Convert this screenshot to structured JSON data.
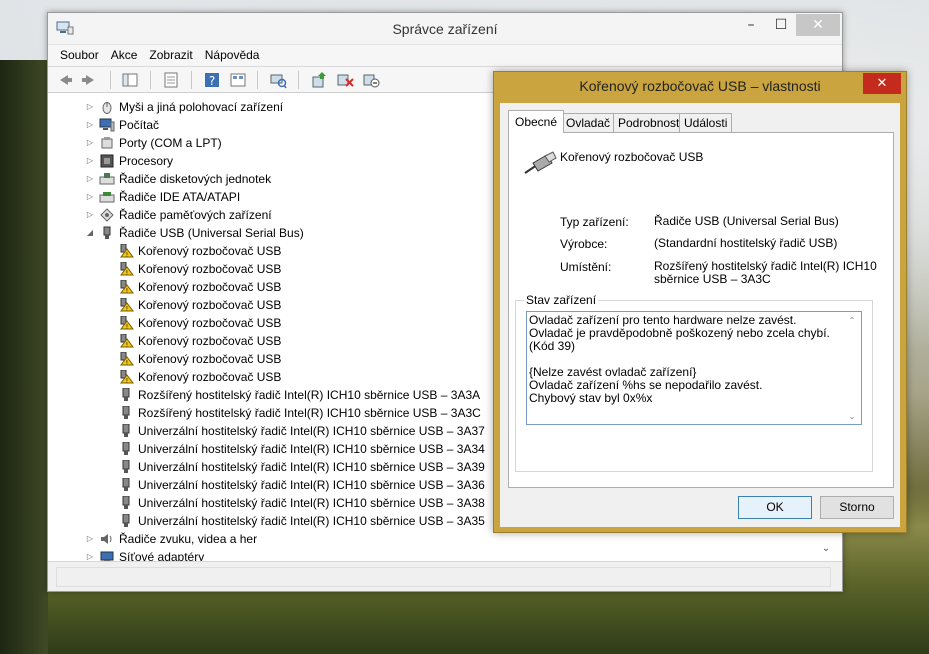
{
  "main_window": {
    "title": "Správce zařízení",
    "minimize": "–",
    "maximize": "☐",
    "close": "✕",
    "menu": [
      "Soubor",
      "Akce",
      "Zobrazit",
      "Nápověda"
    ],
    "toolbar_icons": [
      "back-icon",
      "forward-icon",
      "show-hide-tree-icon",
      "properties-icon",
      "help-icon",
      "view-icon",
      "scan-hardware-icon",
      "update-driver-icon",
      "uninstall-icon",
      "disable-icon"
    ],
    "tree": [
      {
        "label": "Myši a jiná polohovací zařízení",
        "level": 0,
        "expander": "▷",
        "icon": "mouse-icon"
      },
      {
        "label": "Počítač",
        "level": 0,
        "expander": "▷",
        "icon": "computer-icon"
      },
      {
        "label": "Porty (COM a LPT)",
        "level": 0,
        "expander": "▷",
        "icon": "port-icon"
      },
      {
        "label": "Procesory",
        "level": 0,
        "expander": "▷",
        "icon": "processor-icon"
      },
      {
        "label": "Řadiče disketových jednotek",
        "level": 0,
        "expander": "▷",
        "icon": "floppy-controller-icon"
      },
      {
        "label": "Řadiče IDE ATA/ATAPI",
        "level": 0,
        "expander": "▷",
        "icon": "ide-controller-icon"
      },
      {
        "label": "Řadiče paměťových zařízení",
        "level": 0,
        "expander": "▷",
        "icon": "storage-controller-icon"
      },
      {
        "label": "Řadiče USB (Universal Serial Bus)",
        "level": 0,
        "expander": "◢",
        "icon": "usb-icon"
      },
      {
        "label": "Kořenový rozbočovač USB",
        "level": 1,
        "icon": "usb-warning-icon",
        "warning": true
      },
      {
        "label": "Kořenový rozbočovač USB",
        "level": 1,
        "icon": "usb-warning-icon",
        "warning": true
      },
      {
        "label": "Kořenový rozbočovač USB",
        "level": 1,
        "icon": "usb-warning-icon",
        "warning": true
      },
      {
        "label": "Kořenový rozbočovač USB",
        "level": 1,
        "icon": "usb-warning-icon",
        "warning": true
      },
      {
        "label": "Kořenový rozbočovač USB",
        "level": 1,
        "icon": "usb-warning-icon",
        "warning": true
      },
      {
        "label": "Kořenový rozbočovač USB",
        "level": 1,
        "icon": "usb-warning-icon",
        "warning": true
      },
      {
        "label": "Kořenový rozbočovač USB",
        "level": 1,
        "icon": "usb-warning-icon",
        "warning": true
      },
      {
        "label": "Kořenový rozbočovač USB",
        "level": 1,
        "icon": "usb-warning-icon",
        "warning": true
      },
      {
        "label": "Rozšířený hostitelský řadič Intel(R) ICH10 sběrnice USB – 3A3A",
        "level": 1,
        "icon": "usb-icon"
      },
      {
        "label": "Rozšířený hostitelský řadič Intel(R) ICH10 sběrnice USB – 3A3C",
        "level": 1,
        "icon": "usb-icon"
      },
      {
        "label": "Univerzální hostitelský řadič Intel(R) ICH10 sběrnice USB – 3A37",
        "level": 1,
        "icon": "usb-icon"
      },
      {
        "label": "Univerzální hostitelský řadič Intel(R) ICH10 sběrnice USB – 3A34",
        "level": 1,
        "icon": "usb-icon"
      },
      {
        "label": "Univerzální hostitelský řadič Intel(R) ICH10 sběrnice USB – 3A39",
        "level": 1,
        "icon": "usb-icon"
      },
      {
        "label": "Univerzální hostitelský řadič Intel(R) ICH10 sběrnice USB – 3A36",
        "level": 1,
        "icon": "usb-icon"
      },
      {
        "label": "Univerzální hostitelský řadič Intel(R) ICH10 sběrnice USB – 3A38",
        "level": 1,
        "icon": "usb-icon"
      },
      {
        "label": "Univerzální hostitelský řadič Intel(R) ICH10 sběrnice USB – 3A35",
        "level": 1,
        "icon": "usb-icon"
      },
      {
        "label": "Řadiče zvuku, videa a her",
        "level": 0,
        "expander": "▷",
        "icon": "sound-icon"
      },
      {
        "label": "Síťové adaptéry",
        "level": 0,
        "expander": "▷",
        "icon": "network-icon"
      }
    ],
    "scroll_down": "⌄"
  },
  "dialog": {
    "title": "Kořenový rozbočovač USB – vlastnosti",
    "close": "✕",
    "tabs": [
      "Obecné",
      "Ovladač",
      "Podrobnosti",
      "Události"
    ],
    "active_tab": "Obecné",
    "device_name": "Kořenový rozbočovač USB",
    "properties": [
      {
        "label": "Typ zařízení:",
        "value": "Řadiče USB (Universal Serial Bus)"
      },
      {
        "label": "Výrobce:",
        "value": "(Standardní hostitelský řadič USB)"
      },
      {
        "label": "Umístění:",
        "value": "Rozšířený hostitelský řadič Intel(R) ICH10 sběrnice USB – 3A3C"
      }
    ],
    "status_group_label": "Stav zařízení",
    "status_lines": [
      "Ovladač zařízení pro tento hardware nelze zavést. Ovladač je pravděpodobně poškozený nebo zcela chybí. (Kód 39)",
      "{Nelze zavést ovladač zařízení}",
      "Ovladač zařízení %hs se nepodařilo zavést.",
      "Chybový stav byl 0x%x"
    ],
    "ok_label": "OK",
    "cancel_label": "Storno"
  },
  "colors": {
    "dialog_frame": "#c9a43f",
    "close_red": "#c42b1c",
    "warning_yellow": "#f5c518",
    "status_border": "#7a9cc8"
  }
}
